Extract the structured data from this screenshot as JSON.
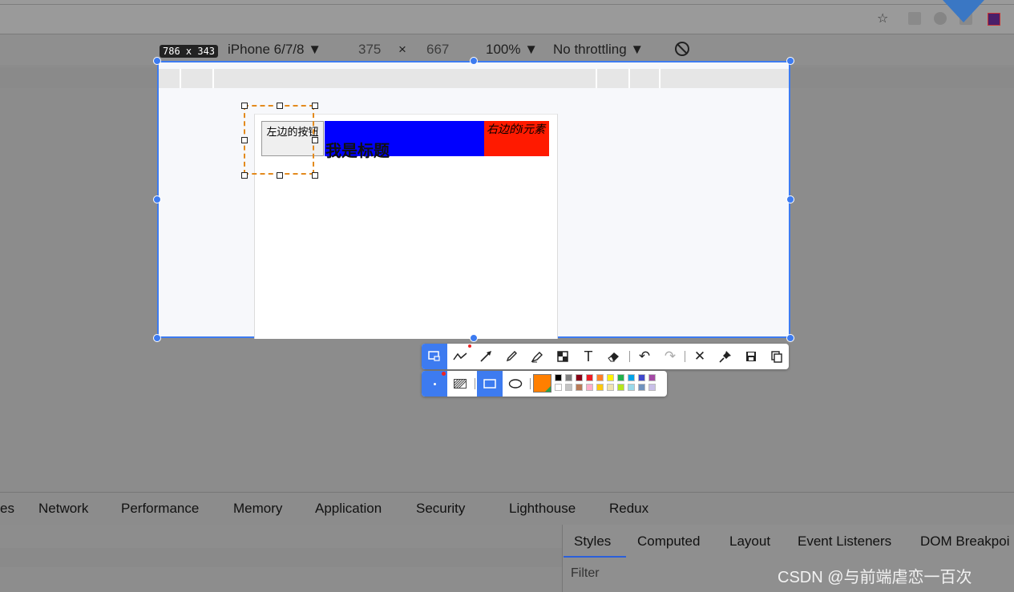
{
  "device_toolbar": {
    "size_badge": "786 x 343",
    "device": "iPhone 6/7/8",
    "width": "375",
    "times": "×",
    "height": "667",
    "zoom": "100%",
    "throttling": "No throttling"
  },
  "page": {
    "left_button": "左边的按钮",
    "title": "我是标题",
    "right_element": "右边的i元素"
  },
  "devtools_tabs": [
    "es",
    "Network",
    "Performance",
    "Memory",
    "Application",
    "Security",
    "Lighthouse",
    "Redux"
  ],
  "styles_tabs": [
    "Styles",
    "Computed",
    "Layout",
    "Event Listeners",
    "DOM Breakpoi"
  ],
  "filter_placeholder": "Filter",
  "watermark": "CSDN @与前端虐恋一百次",
  "palette_top": [
    "#000000",
    "#7f7f7f",
    "#880015",
    "#ed1c24",
    "#ff7f27",
    "#fff200",
    "#22b14c",
    "#00a2e8",
    "#3f48cc",
    "#a349a4"
  ],
  "palette_bottom": [
    "#ffffff",
    "#c3c3c3",
    "#b97a57",
    "#ffaec9",
    "#ffc90e",
    "#efe4b0",
    "#b5e61d",
    "#99d9ea",
    "#7092be",
    "#c8bfe7"
  ],
  "current_color": "#ff7f00",
  "accent": "#3d7bf0"
}
